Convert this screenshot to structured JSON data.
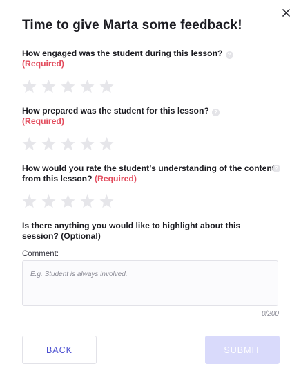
{
  "dialog": {
    "title": "Time to give Marta some feedback!"
  },
  "questions": [
    {
      "text": "How engaged was the student during this lesson?",
      "requirement": "(Required)",
      "rating": 0,
      "max_rating": 5
    },
    {
      "text": "How prepared was the student for this lesson?",
      "requirement": "(Required)",
      "rating": 0,
      "max_rating": 5
    },
    {
      "text": "How would you rate the student’s understanding of the content from this lesson?",
      "requirement": "(Required)",
      "rating": 0,
      "max_rating": 5
    },
    {
      "text": "Is there anything you would like to highlight about this session?",
      "requirement": "(Optional)"
    }
  ],
  "comment": {
    "label": "Comment:",
    "placeholder": "E.g. Student is always involved.",
    "value": "",
    "counter": "0/200"
  },
  "buttons": {
    "back": "BACK",
    "submit": "SUBMIT"
  },
  "colors": {
    "required": "#e34d5e",
    "accent": "#4b4fd0",
    "submit_disabled": "#d9dafb",
    "star_empty": "#e6e6ea"
  },
  "icons": {
    "close": "close-icon",
    "help": "help-icon",
    "star": "star-icon"
  }
}
